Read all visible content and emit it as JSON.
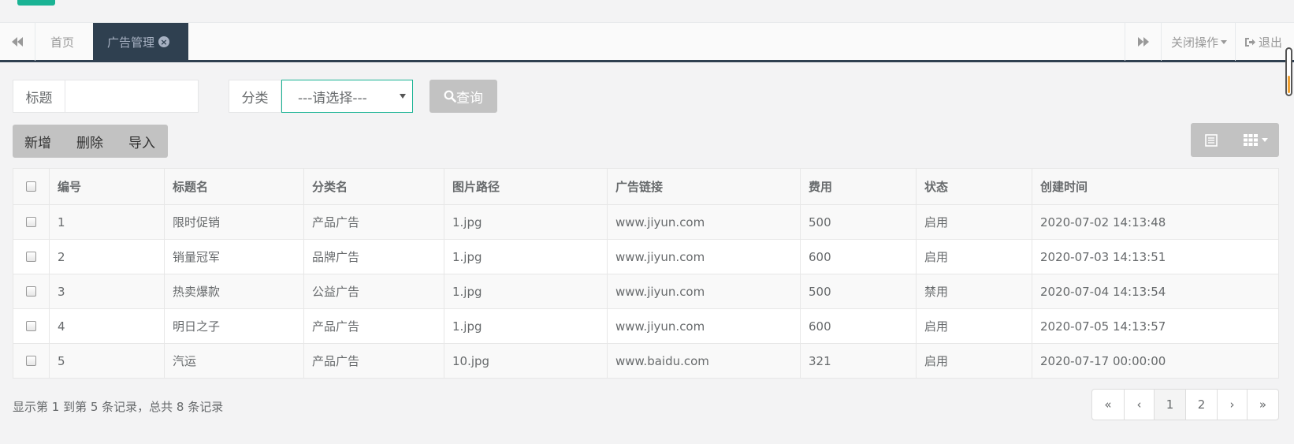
{
  "tabs": {
    "home_label": "首页",
    "active_label": "广告管理",
    "close_ops_label": "关闭操作",
    "logout_label": "退出"
  },
  "search": {
    "title_label": "标题",
    "title_value": "",
    "category_label": "分类",
    "category_selected": "---请选择---",
    "query_label": "查询"
  },
  "toolbar": {
    "add_label": "新增",
    "delete_label": "删除",
    "import_label": "导入"
  },
  "table": {
    "headers": [
      "编号",
      "标题名",
      "分类名",
      "图片路径",
      "广告链接",
      "费用",
      "状态",
      "创建时间"
    ],
    "rows": [
      [
        "1",
        "限时促销",
        "产品广告",
        "1.jpg",
        "www.jiyun.com",
        "500",
        "启用",
        "2020-07-02 14:13:48"
      ],
      [
        "2",
        "销量冠军",
        "品牌广告",
        "1.jpg",
        "www.jiyun.com",
        "600",
        "启用",
        "2020-07-03 14:13:51"
      ],
      [
        "3",
        "热卖爆款",
        "公益广告",
        "1.jpg",
        "www.jiyun.com",
        "500",
        "禁用",
        "2020-07-04 14:13:54"
      ],
      [
        "4",
        "明日之子",
        "产品广告",
        "1.jpg",
        "www.jiyun.com",
        "600",
        "启用",
        "2020-07-05 14:13:57"
      ],
      [
        "5",
        "汽运",
        "产品广告",
        "10.jpg",
        "www.baidu.com",
        "321",
        "启用",
        "2020-07-17 00:00:00"
      ]
    ]
  },
  "footer": {
    "info": "显示第 1 到第 5 条记录，总共 8 条记录"
  },
  "pagination": {
    "first": "«",
    "prev": "‹",
    "pages": [
      "1",
      "2"
    ],
    "current": "1",
    "next": "›",
    "last": "»"
  },
  "colors": {
    "accent": "#1ab394",
    "tab_active_bg": "#2f4050",
    "button_gray": "#c2c2c2"
  }
}
